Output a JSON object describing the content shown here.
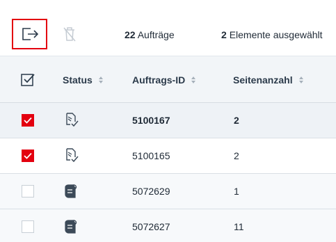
{
  "toolbar": {
    "export_icon": "export-arrow-icon",
    "delete_icon": "delete-trash-icon",
    "job_count": "22",
    "job_count_label": "Aufträge",
    "selected_count": "2",
    "selected_label": "Elemente ausgewählt"
  },
  "table": {
    "columns": [
      {
        "label": "Status"
      },
      {
        "label": "Auftrags-ID"
      },
      {
        "label": "Seitenanzahl"
      }
    ],
    "rows": [
      {
        "selected": true,
        "status_icon": "print-job-done-icon",
        "id": "5100167",
        "pages": "2"
      },
      {
        "selected": true,
        "status_icon": "print-job-done-icon",
        "id": "5100165",
        "pages": "2"
      },
      {
        "selected": false,
        "status_icon": "paper-roll-icon",
        "id": "5072629",
        "pages": "1"
      },
      {
        "selected": false,
        "status_icon": "paper-roll-icon",
        "id": "5072627",
        "pages": "11"
      }
    ]
  },
  "colors": {
    "accent_red": "#e3000f",
    "header_bg": "#f2f5f8",
    "text": "#1f2a36"
  }
}
